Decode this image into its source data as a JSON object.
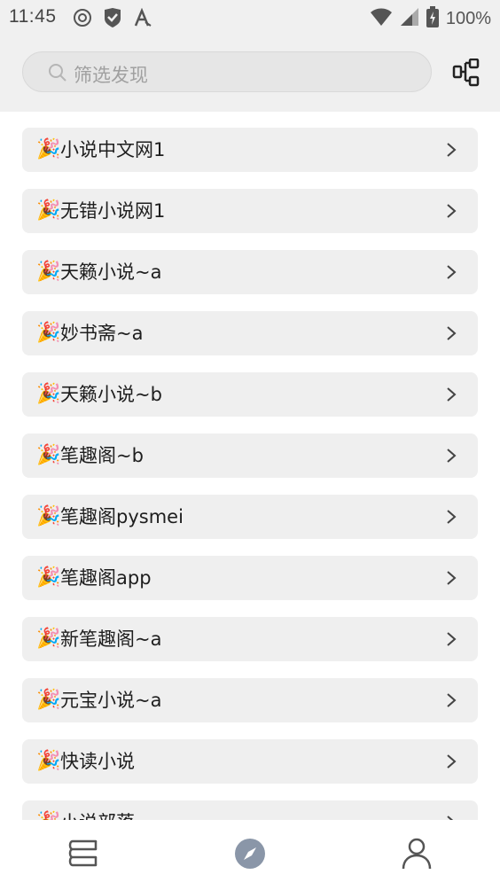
{
  "status_bar": {
    "time": "11:45",
    "battery": "100%",
    "icons_left": [
      "at-sign-icon",
      "shield-check-icon",
      "a-font-icon"
    ],
    "icons_right": [
      "wifi-icon",
      "cellular-signal-icon",
      "battery-charging-icon"
    ]
  },
  "search": {
    "placeholder": "筛选发现"
  },
  "items": [
    {
      "emoji": "🎉",
      "label": "小说中文网1"
    },
    {
      "emoji": "🎉",
      "label": "无错小说网1"
    },
    {
      "emoji": "🎉",
      "label": "天籁小说~a"
    },
    {
      "emoji": "🎉",
      "label": "妙书斋~a"
    },
    {
      "emoji": "🎉",
      "label": "天籁小说~b"
    },
    {
      "emoji": "🎉",
      "label": "笔趣阁~b"
    },
    {
      "emoji": "🎉",
      "label": "笔趣阁pysmei"
    },
    {
      "emoji": "🎉",
      "label": "笔趣阁app"
    },
    {
      "emoji": "🎉",
      "label": "新笔趣阁~a"
    },
    {
      "emoji": "🎉",
      "label": "元宝小说~a"
    },
    {
      "emoji": "🎉",
      "label": "快读小说"
    },
    {
      "emoji": "🎉",
      "label": "小说部落"
    }
  ],
  "bottom_nav": {
    "tabs": [
      {
        "name": "bookshelf",
        "icon": "bookshelf-icon",
        "active": false
      },
      {
        "name": "discover",
        "icon": "compass-icon",
        "active": true
      },
      {
        "name": "profile",
        "icon": "person-icon",
        "active": false
      }
    ]
  },
  "colors": {
    "header_bg": "#f0f0f0",
    "item_bg": "#efefef",
    "active_nav": "#8a96a8",
    "icon_gray": "#555555"
  }
}
